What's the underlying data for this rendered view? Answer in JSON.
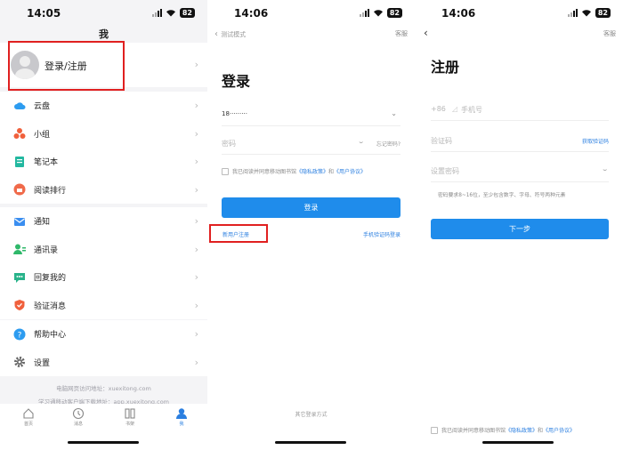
{
  "screens": [
    {
      "time": "14:05",
      "battery": "82",
      "title": "我",
      "profile_label": "登录/注册",
      "menu_groups": [
        [
          {
            "label": "云盘",
            "icon": "cloud-icon",
            "color": "#2d9cf0"
          },
          {
            "label": "小组",
            "icon": "group-icon",
            "color": "#f0603c"
          },
          {
            "label": "笔记本",
            "icon": "notebook-icon",
            "color": "#23b8a0"
          },
          {
            "label": "阅读排行",
            "icon": "ranking-icon",
            "color": "#f06a4a"
          }
        ],
        [
          {
            "label": "通知",
            "icon": "mail-icon",
            "color": "#3a8ef0"
          },
          {
            "label": "通讯录",
            "icon": "contacts-icon",
            "color": "#2fb86a"
          },
          {
            "label": "回复我的",
            "icon": "reply-icon",
            "color": "#28b38a"
          },
          {
            "label": "验证消息",
            "icon": "shield-icon",
            "color": "#f0603c"
          }
        ],
        [
          {
            "label": "帮助中心",
            "icon": "help-icon",
            "color": "#2d9cf0"
          },
          {
            "label": "设置",
            "icon": "gear-icon",
            "color": "#666666"
          }
        ]
      ],
      "footer_line1": "电脑网页访问地址：xuexitong.com",
      "footer_line2": "学习通移动客户端下载地址：app.xuexitong.com",
      "tabs": [
        {
          "label": "首页",
          "icon": "home-icon"
        },
        {
          "label": "消息",
          "icon": "message-icon"
        },
        {
          "label": "书架",
          "icon": "bookshelf-icon"
        },
        {
          "label": "我",
          "icon": "person-icon",
          "active": true
        }
      ]
    },
    {
      "time": "14:06",
      "battery": "82",
      "nav_back": "测试模式",
      "nav_right": "客服",
      "title": "登录",
      "phone_value": "18·········",
      "password_placeholder": "密码",
      "forgot_password": "忘记密码?",
      "agree_prefix": "我已阅读并同意移动图书馆",
      "privacy_policy": "《隐私政策》",
      "agree_and": "和",
      "user_agreement": "《用户协议》",
      "login_button": "登录",
      "new_user_register": "新用户注册",
      "sms_login": "手机验证码登录",
      "other_login": "其它登录方式"
    },
    {
      "time": "14:06",
      "battery": "82",
      "nav_right": "客服",
      "title": "注册",
      "country_code": "+86",
      "phone_placeholder": "手机号",
      "code_placeholder": "验证码",
      "get_code": "获取验证码",
      "password_placeholder": "设置密码",
      "password_hint": "密码要求8~16位，至少包含数字、字母、符号两种元素",
      "next_button": "下一步",
      "agree_prefix": "我已阅读并同意移动图书馆",
      "privacy_policy": "《隐私政策》",
      "agree_and": "和",
      "user_agreement": "《用户协议》"
    }
  ],
  "colors": {
    "accent": "#1f8ceb",
    "highlight": "#e02020",
    "tab_active": "#2b7fe0"
  }
}
